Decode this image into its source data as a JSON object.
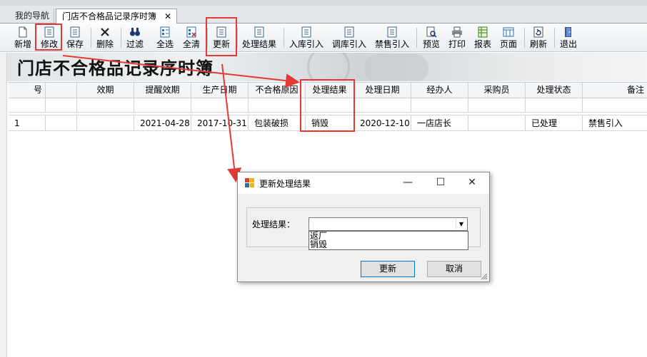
{
  "tabs": {
    "nav_label": "我的导航",
    "active_label": "门店不合格品记录序时簿",
    "close_glyph": "✕"
  },
  "toolbar": {
    "items": [
      {
        "label": "新增",
        "icon": "new-doc-icon"
      },
      {
        "label": "修改",
        "icon": "edit-list-icon"
      },
      {
        "label": "保存",
        "icon": "save-icon"
      },
      {
        "label": "删除",
        "icon": "delete-x-icon"
      },
      {
        "label": "过滤",
        "icon": "binoculars-icon"
      },
      {
        "label": "全选",
        "icon": "select-all-icon"
      },
      {
        "label": "全清",
        "icon": "clear-all-icon"
      },
      {
        "label": "更新",
        "icon": "update-list-icon"
      },
      {
        "label": "处理结果",
        "icon": "result-list-icon"
      },
      {
        "label": "入库引入",
        "icon": "import-icon"
      },
      {
        "label": "调库引入",
        "icon": "import-icon"
      },
      {
        "label": "禁售引入",
        "icon": "import-icon"
      },
      {
        "label": "预览",
        "icon": "preview-icon"
      },
      {
        "label": "打印",
        "icon": "printer-icon"
      },
      {
        "label": "报表",
        "icon": "report-icon"
      },
      {
        "label": "页面",
        "icon": "page-icon"
      },
      {
        "label": "刷新",
        "icon": "refresh-icon"
      },
      {
        "label": "退出",
        "icon": "exit-door-icon"
      }
    ]
  },
  "banner": {
    "title": "门店不合格品记录序时簿"
  },
  "grid": {
    "columns": [
      "号",
      "效期",
      "提醒效期",
      "生产日期",
      "不合格原因",
      "处理结果",
      "处理日期",
      "经办人",
      "采购员",
      "处理状态",
      "备注"
    ],
    "rows": [
      {
        "no": "1",
        "c1": "",
        "c2": "",
        "c3": "2021-04-28",
        "c4": "2017-10-31",
        "c5": "包装破损",
        "c6": "销毁",
        "c7": "2020-12-10",
        "c8": "一店店长",
        "c9": "",
        "c10": "已处理",
        "c11": "禁售引入"
      }
    ]
  },
  "dialog": {
    "title": "更新处理结果",
    "minimize": "—",
    "maximize": "☐",
    "close": "✕",
    "field_label": "处理结果：",
    "field_value": "",
    "options": [
      "返厂",
      "销毁"
    ],
    "ok_label": "更新",
    "cancel_label": "取消"
  },
  "colors": {
    "highlight": "#e53935",
    "accent": "#0078d7"
  }
}
